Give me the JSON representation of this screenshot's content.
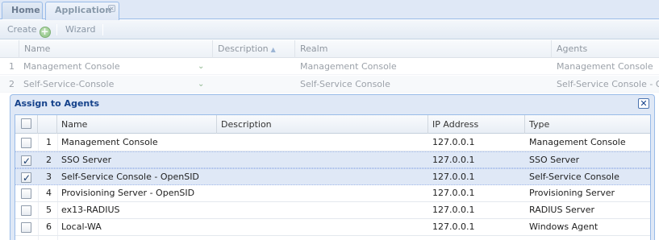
{
  "tabs": [
    {
      "label": "Home"
    },
    {
      "label": "Application",
      "close": "×"
    }
  ],
  "toolbar": {
    "create_label": "Create",
    "create_icon": "plus-circle-icon",
    "wizard_label": "Wizard"
  },
  "grid": {
    "columns": [
      "Name",
      "Description",
      "Realm",
      "Agents"
    ],
    "rows": [
      {
        "num": "1",
        "name": "Management Console",
        "description": "",
        "realm": "Management Console",
        "agents": "Management Console"
      },
      {
        "num": "2",
        "name": "Self-Service-Console",
        "description": "",
        "realm": "Self-Service Console",
        "agents": "Self-Service Console - OpenSID"
      }
    ]
  },
  "dialog": {
    "title": "Assign to Agents",
    "close": "✕",
    "columns": [
      "Name",
      "Description",
      "IP Address",
      "Type"
    ],
    "rows": [
      {
        "num": "1",
        "checked": false,
        "name": "Management Console",
        "description": "",
        "ip": "127.0.0.1",
        "type": "Management Console"
      },
      {
        "num": "2",
        "checked": true,
        "name": "SSO Server",
        "description": "",
        "ip": "127.0.0.1",
        "type": "SSO Server"
      },
      {
        "num": "3",
        "checked": true,
        "name": "Self-Service Console - OpenSID",
        "description": "",
        "ip": "127.0.0.1",
        "type": "Self-Service Console"
      },
      {
        "num": "4",
        "checked": false,
        "name": "Provisioning Server - OpenSID",
        "description": "",
        "ip": "127.0.0.1",
        "type": "Provisioning Server"
      },
      {
        "num": "5",
        "checked": false,
        "name": "ex13-RADIUS",
        "description": "",
        "ip": "127.0.0.1",
        "type": "RADIUS Server"
      },
      {
        "num": "6",
        "checked": false,
        "name": "Local-WA",
        "description": "",
        "ip": "127.0.0.1",
        "type": "Windows Agent"
      }
    ]
  },
  "colors": {
    "accent": "#15428b",
    "selection": "#dfe8f6",
    "border": "#99bbe8"
  }
}
